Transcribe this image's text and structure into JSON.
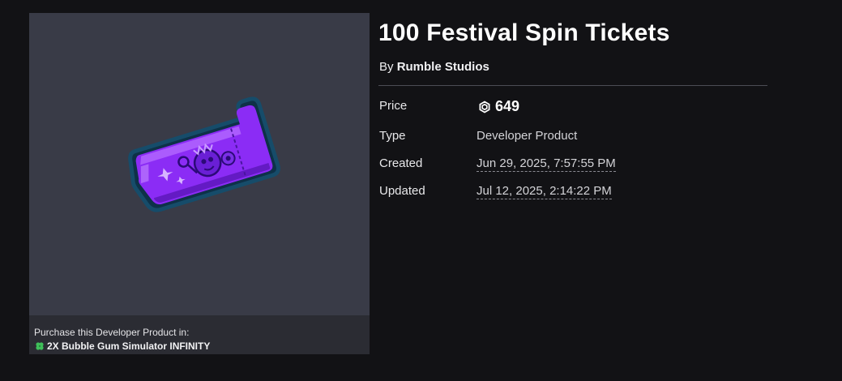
{
  "item": {
    "title": "100 Festival Spin Tickets",
    "by_label": "By",
    "creator": "Rumble Studios"
  },
  "details": {
    "price_label": "Price",
    "price_value": "649",
    "price_icon": "robux-icon",
    "type_label": "Type",
    "type_value": "Developer Product",
    "created_label": "Created",
    "created_value": "Jun 29, 2025, 7:57:55 PM",
    "updated_label": "Updated",
    "updated_value": "Jul 12, 2025, 2:14:22 PM"
  },
  "thumbnail": {
    "image": "purple-ticket-icon",
    "purchase_caption": "Purchase this Developer Product in:",
    "experience_icon": "clover-icon",
    "experience_name": "2X Bubble Gum Simulator INFINITY"
  },
  "colors": {
    "background": "#121215",
    "thumb_bg": "#393b47",
    "thumb_footer_bg": "#2b2c33",
    "ticket_purple": "#8b2cf5",
    "ticket_outline": "#0f3a52",
    "clover_green": "#3fbf5a"
  }
}
